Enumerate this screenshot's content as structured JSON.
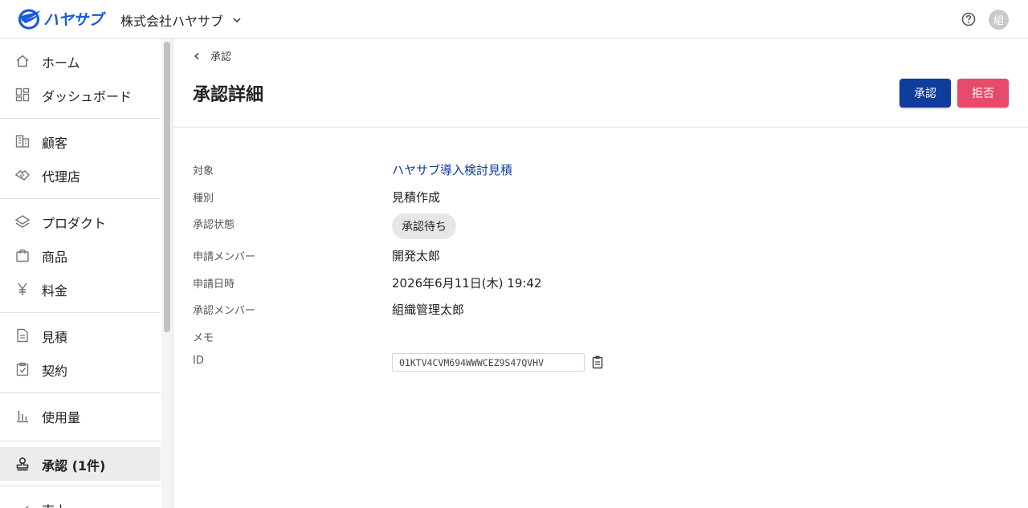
{
  "header": {
    "logo_text": "ハヤサブ",
    "org_name": "株式会社ハヤサブ",
    "avatar_text": "組",
    "icons": {
      "help": "help-circle-icon",
      "org_dropdown": "chevron-down-icon"
    }
  },
  "sidebar": {
    "items": [
      {
        "label": "ホーム",
        "icon": "home-icon"
      },
      {
        "label": "ダッシュボード",
        "icon": "dashboard-icon"
      },
      {
        "label": "顧客",
        "icon": "building-icon"
      },
      {
        "label": "代理店",
        "icon": "handshake-icon"
      },
      {
        "label": "プロダクト",
        "icon": "layers-icon"
      },
      {
        "label": "商品",
        "icon": "shopping-bag-icon"
      },
      {
        "label": "料金",
        "icon": "yen-icon"
      },
      {
        "label": "見積",
        "icon": "document-icon"
      },
      {
        "label": "契約",
        "icon": "clipboard-check-icon"
      },
      {
        "label": "使用量",
        "icon": "bar-chart-icon"
      },
      {
        "label": "承認 (1件)",
        "icon": "stamp-icon",
        "active": true
      },
      {
        "label": "売上",
        "icon": "sales-icon"
      }
    ]
  },
  "main": {
    "breadcrumb": "承認",
    "title": "承認詳細",
    "approve_button": "承認",
    "reject_button": "拒否",
    "fields": {
      "target_label": "対象",
      "target_value": "ハヤサブ導入検討見積",
      "type_label": "種別",
      "type_value": "見積作成",
      "status_label": "承認状態",
      "status_value": "承認待ち",
      "requester_label": "申請メンバー",
      "requester_value": "開発太郎",
      "requested_at_label": "申請日時",
      "requested_at_value": "2026年6月11日(木) 19:42",
      "approver_label": "承認メンバー",
      "approver_value": "組織管理太郎",
      "memo_label": "メモ",
      "id_label": "ID",
      "id_value": "01KTV4CVM694WWWCEZ9S47QVHV"
    }
  },
  "colors": {
    "primary": "#0e3d9c",
    "danger": "#e84a6a",
    "logo": "#1a5bd6",
    "active_nav_bg": "#ececec"
  }
}
